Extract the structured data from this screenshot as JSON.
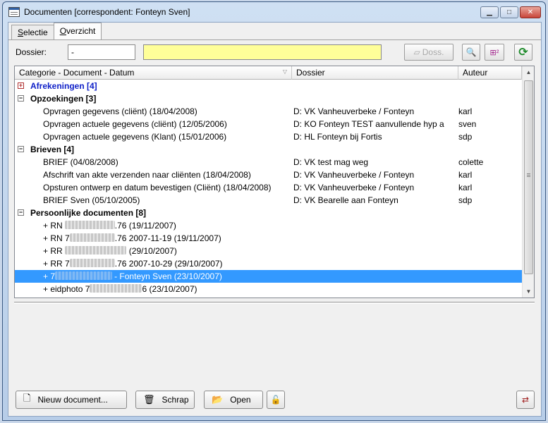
{
  "window": {
    "title": "Documenten  [correspondent: Fonteyn Sven]"
  },
  "tabs": [
    {
      "label": "Selectie",
      "accel": "S",
      "rest": "electie"
    },
    {
      "label": "Overzicht",
      "accel": "O",
      "rest": "verzicht"
    }
  ],
  "dossier": {
    "label": "Dossier:",
    "value": "-",
    "extra_value": "",
    "doss_button": "Doss."
  },
  "grid": {
    "columns": [
      "Categorie - Document - Datum",
      "Dossier",
      "Auteur"
    ],
    "groups": [
      {
        "title": "Afrekeningen [4]",
        "expanded": false,
        "highlight": true,
        "rows": []
      },
      {
        "title": "Opzoekingen [3]",
        "expanded": true,
        "highlight": false,
        "rows": [
          {
            "doc": "Opvragen gegevens (cliënt) (18/04/2008)",
            "dossier": "D: VK Vanheuverbeke / Fonteyn",
            "auteur": "karl"
          },
          {
            "doc": "Opvragen actuele gegevens (cliënt) (12/05/2006)",
            "dossier": "D: KO Fonteyn TEST aanvullende hyp a",
            "auteur": "sven"
          },
          {
            "doc": "Opvragen actuele gegevens (Klant) (15/01/2006)",
            "dossier": "D: HL Fonteyn bij Fortis",
            "auteur": "sdp"
          }
        ]
      },
      {
        "title": "Brieven [4]",
        "expanded": true,
        "highlight": false,
        "rows": [
          {
            "doc": "BRIEF (04/08/2008)",
            "dossier": "D: VK  test mag weg",
            "auteur": "colette"
          },
          {
            "doc": "Afschrift van akte verzenden naar cliënten (18/04/2008)",
            "dossier": "D: VK Vanheuverbeke / Fonteyn",
            "auteur": "karl"
          },
          {
            "doc": "Opsturen ontwerp en datum bevestigen (Cliënt) (18/04/2008)",
            "dossier": "D: VK Vanheuverbeke / Fonteyn",
            "auteur": "karl"
          },
          {
            "doc": "BRIEF Sven (05/10/2005)",
            "dossier": "D: VK Bearelle aan Fonteyn",
            "auteur": "sdp"
          }
        ]
      },
      {
        "title": "Persoonlijke documenten [8]",
        "expanded": true,
        "highlight": false,
        "rows": [
          {
            "pre": "+ RN ",
            "blurred": "76.08.25-251",
            "post": ".76 (19/11/2007)",
            "dossier": "",
            "auteur": ""
          },
          {
            "pre": "+ RN 7",
            "blurred": "6.05.25-251",
            "post": ".76 2007-11-19 (19/11/2007)",
            "dossier": "",
            "auteur": ""
          },
          {
            "pre": "+ RR ",
            "blurred": "76.08.25-251.76",
            "post": " (29/10/2007)",
            "dossier": "",
            "auteur": ""
          },
          {
            "pre": "+ RR 7",
            "blurred": "6.08.25-251",
            "post": ".76 2007-10-29 (29/10/2007)",
            "dossier": "",
            "auteur": ""
          },
          {
            "pre": "+ 7",
            "blurred": "6.08.25-251.76",
            "post": " - Fonteyn Sven (23/10/2007)",
            "dossier": "",
            "auteur": "",
            "selected": true
          },
          {
            "pre": "+ eidphoto 7",
            "blurred": "6.08.25-251.7",
            "post": "6 (23/10/2007)",
            "dossier": "",
            "auteur": ""
          }
        ]
      }
    ]
  },
  "buttons": {
    "new_doc": "Nieuw document...",
    "delete": "Schrap",
    "open": "Open"
  },
  "icons": {
    "new_doc": "document-icon",
    "delete": "trash-icon",
    "open": "folder-open-icon",
    "lock": "lock-icon",
    "search": "search-icon",
    "refresh": "refresh-icon",
    "export": "export-icon"
  },
  "colors": {
    "selection": "#3399ff",
    "group_link": "#0f20c8",
    "yellow_field": "#ffff99"
  }
}
